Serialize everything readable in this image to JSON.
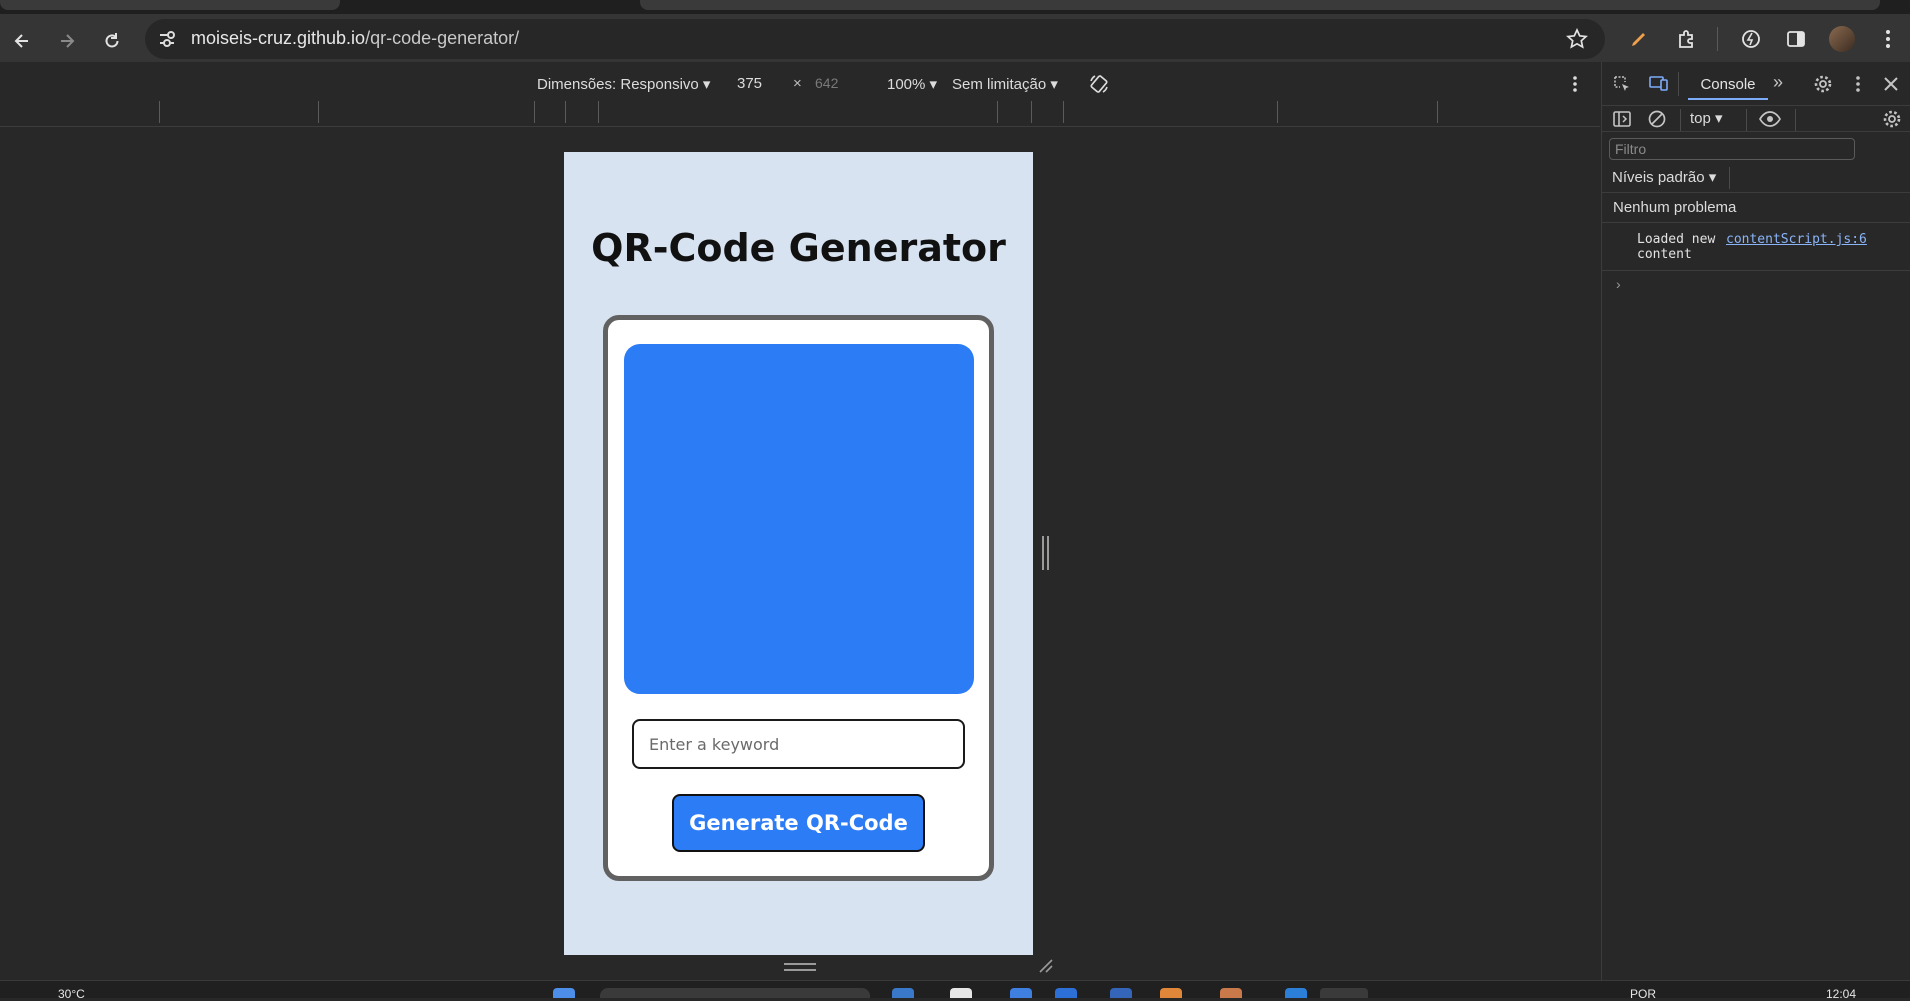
{
  "browser": {
    "url_host": "moiseis-cruz.github.io",
    "url_path": "/qr-code-generator/"
  },
  "device_toolbar": {
    "dimensions_label": "Dimensões: Responsivo",
    "width": "375",
    "times": "×",
    "height": "642",
    "zoom": "100%",
    "throttling": "Sem limitação"
  },
  "page": {
    "title": "QR-Code Generator",
    "input_placeholder": "Enter a keyword",
    "button_label": "Generate QR-Code",
    "accent_color": "#2c7cf6",
    "background_color": "#d8e3f1"
  },
  "devtools": {
    "tab_console": "Console",
    "context": "top",
    "filter_placeholder": "Filtro",
    "levels": "Níveis padrão",
    "issues": "Nenhum problema",
    "log_message_line1": "Loaded new",
    "log_message_line2": "content",
    "log_source": "contentScript.js:6"
  },
  "taskbar": {
    "temperature": "30°C",
    "language": "POR",
    "time": "12:04"
  },
  "icons": [
    "back-icon",
    "forward-icon",
    "reload-icon",
    "site-settings-icon",
    "star-icon",
    "pen-icon",
    "extensions-icon",
    "sidebar-icon",
    "profile-avatar",
    "kebab-menu-icon",
    "rotate-icon",
    "inspect-icon",
    "device-toggle-icon",
    "gear-icon",
    "close-icon",
    "clear-console-icon",
    "eye-icon",
    "chevron-right-icon"
  ]
}
